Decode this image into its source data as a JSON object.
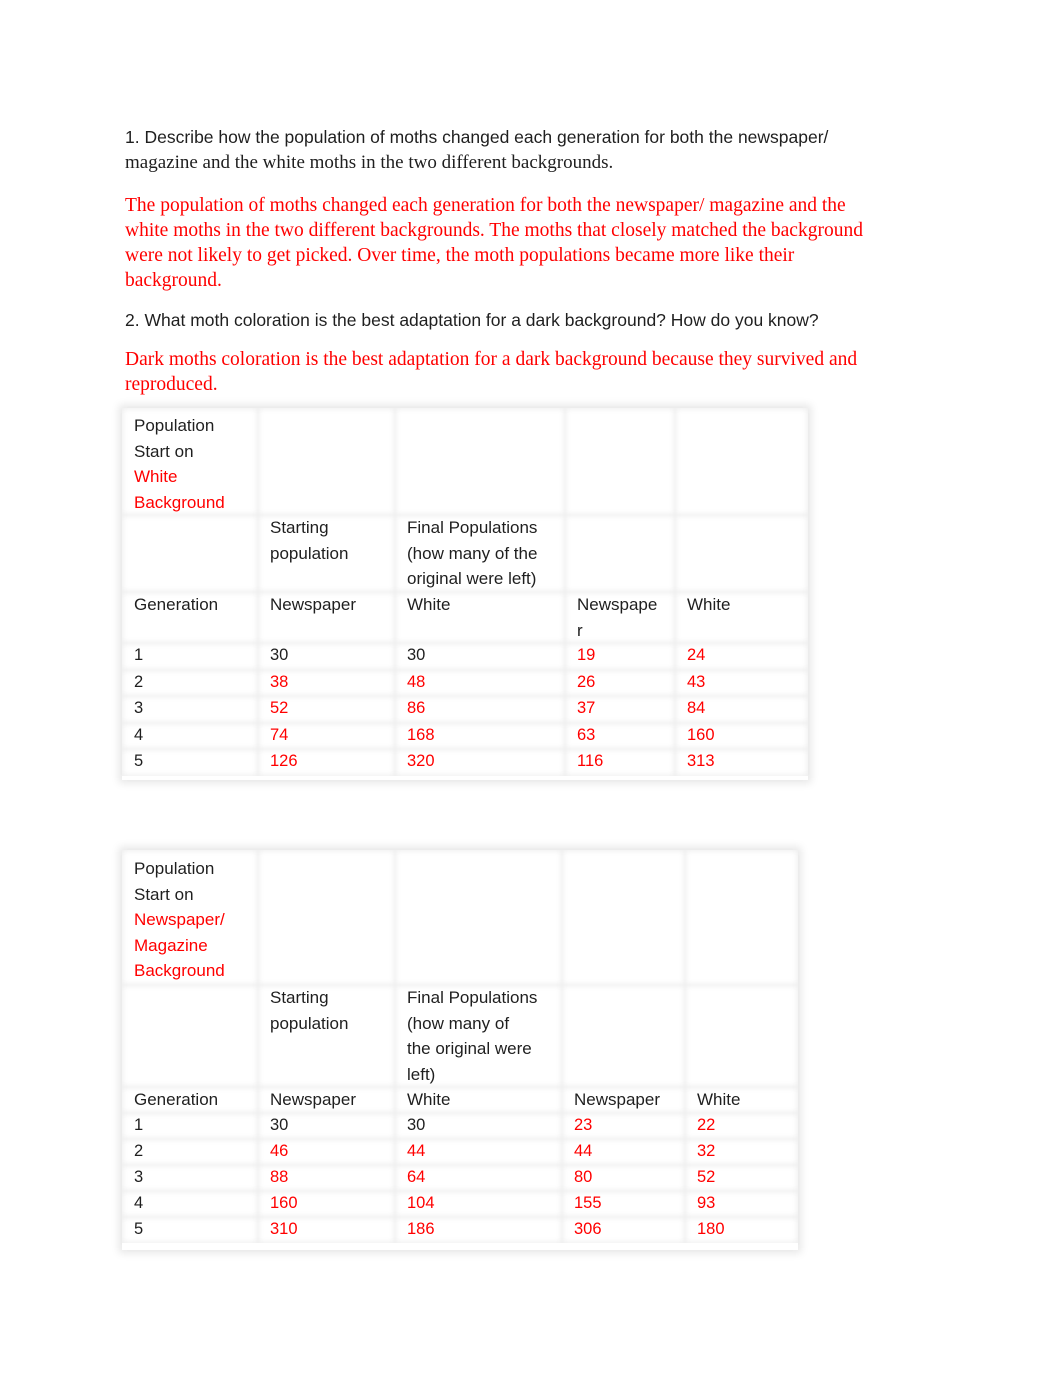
{
  "questions": [
    {
      "number": "1.",
      "lead": "Describe how the population of moths changed each generation for both the newspaper/",
      "continuation": "magazine and the white moths in the two different backgrounds.",
      "answer": "The population of moths changed each generation for both the newspaper/ magazine and the white moths in the two different backgrounds. The moths that closely matched the background were not likely to get picked. Over time, the moth populations became more like their background.",
      "answer_lines": [
        "The population of moths changed each generation for both the newspaper/ magazine and the",
        "white moths in the two different backgrounds. The moths that closely matched the background",
        "were not likely to get picked. Over time, the moth populations became more like their",
        "background."
      ]
    },
    {
      "number": "2.",
      "lead": "What moth coloration is the best adaptation for a dark background? How do you know?",
      "answer_lines": [
        "Dark moths coloration is the best adaptation for a dark background because they survived and",
        "reproduced."
      ]
    }
  ],
  "tables": [
    {
      "title_black": [
        "Population",
        "Start on"
      ],
      "title_red": [
        "White",
        "Background"
      ],
      "header_starting": [
        "Starting",
        "population"
      ],
      "header_final": [
        "Final Populations",
        "(how many of the",
        "original were left)"
      ],
      "columns": [
        "Generation",
        "Newspaper",
        "White",
        "Newspaper",
        "White"
      ],
      "columns_wrapped_4": [
        "Newspape",
        "r"
      ],
      "rows": [
        {
          "generation": "1",
          "start_newspaper": "30",
          "start_white": "30",
          "final_newspaper": "19",
          "final_white": "24"
        },
        {
          "generation": "2",
          "start_newspaper": "38",
          "start_white": "48",
          "final_newspaper": "26",
          "final_white": "43"
        },
        {
          "generation": "3",
          "start_newspaper": "52",
          "start_white": "86",
          "final_newspaper": "37",
          "final_white": "84"
        },
        {
          "generation": "4",
          "start_newspaper": "74",
          "start_white": "168",
          "final_newspaper": "63",
          "final_white": "160"
        },
        {
          "generation": "5",
          "start_newspaper": "126",
          "start_white": "320",
          "final_newspaper": "116",
          "final_white": "313"
        }
      ]
    },
    {
      "title_black": [
        "Population",
        "Start on"
      ],
      "title_red": [
        "Newspaper/",
        "Magazine",
        "Background"
      ],
      "header_starting": [
        "Starting",
        "population"
      ],
      "header_final": [
        "Final Populations",
        "(how many of",
        "the original were",
        "left)"
      ],
      "columns": [
        "Generation",
        "Newspaper",
        "White",
        "Newspaper",
        "White"
      ],
      "rows": [
        {
          "generation": "1",
          "start_newspaper": "30",
          "start_white": "30",
          "final_newspaper": "23",
          "final_white": "22"
        },
        {
          "generation": "2",
          "start_newspaper": "46",
          "start_white": "44",
          "final_newspaper": "44",
          "final_white": "32"
        },
        {
          "generation": "3",
          "start_newspaper": "88",
          "start_white": "64",
          "final_newspaper": "80",
          "final_white": "52"
        },
        {
          "generation": "4",
          "start_newspaper": "160",
          "start_white": "104",
          "final_newspaper": "155",
          "final_white": "93"
        },
        {
          "generation": "5",
          "start_newspaper": "310",
          "start_white": "186",
          "final_newspaper": "306",
          "final_white": "180"
        }
      ]
    }
  ],
  "colors": {
    "answer": "#ff0000",
    "text": "#1f1f1f"
  }
}
